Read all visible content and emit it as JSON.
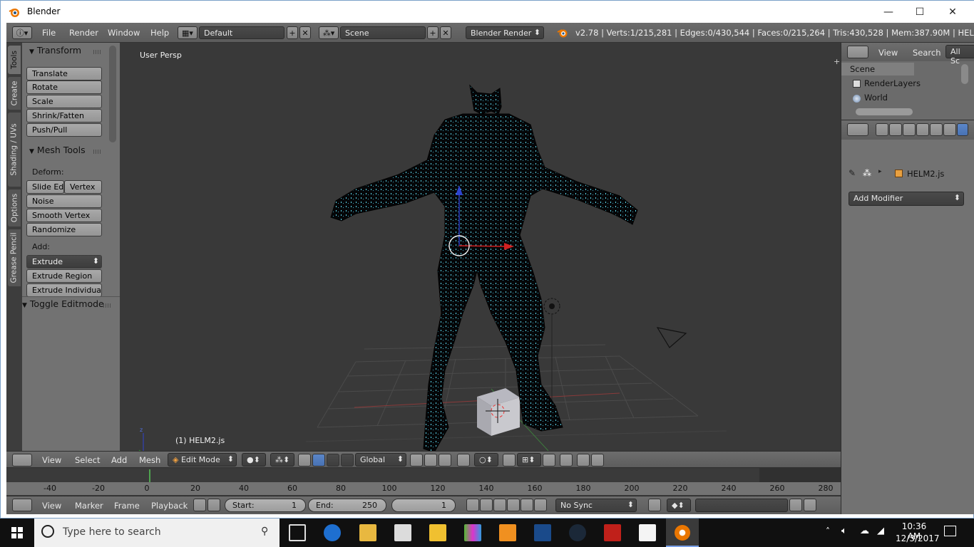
{
  "window": {
    "title": "Blender",
    "controls": [
      "—",
      "☐",
      "✕"
    ]
  },
  "info_header": {
    "menus": [
      "File",
      "Render",
      "Window",
      "Help"
    ],
    "layout": "Default",
    "scene": "Scene",
    "engine": "Blender Render",
    "stats": "v2.78 | Verts:1/215,281 | Edges:0/430,544 | Faces:0/215,264 | Tris:430,528 | Mem:387.90M | HELM2.js"
  },
  "tool_tabs": [
    "Tools",
    "Create",
    "Shading / UVs",
    "Options",
    "Grease Pencil"
  ],
  "toolshelf": {
    "transform_header": "Transform",
    "transform_buttons": [
      "Translate",
      "Rotate",
      "Scale",
      "Shrink/Fatten",
      "Push/Pull"
    ],
    "mesh_tools_header": "Mesh Tools",
    "deform_label": "Deform:",
    "slide_edge": "Slide Ed",
    "vertex": "Vertex",
    "deform_buttons": [
      "Noise",
      "Smooth Vertex",
      "Randomize"
    ],
    "add_label": "Add:",
    "extrude": "Extrude",
    "extrude_region": "Extrude Region",
    "extrude_individual": "Extrude Individual",
    "toggle_editmode_header": "Toggle Editmode"
  },
  "viewport": {
    "view_name": "User Persp",
    "object_label": "(1) HELM2.js"
  },
  "view3d_header": {
    "menus": [
      "View",
      "Select",
      "Add",
      "Mesh"
    ],
    "mode": "Edit Mode",
    "orientation": "Global"
  },
  "timeline": {
    "ticks": [
      "-40",
      "-20",
      "0",
      "20",
      "40",
      "60",
      "80",
      "100",
      "120",
      "140",
      "160",
      "180",
      "200",
      "220",
      "240",
      "260",
      "280"
    ],
    "menus": [
      "View",
      "Marker",
      "Frame",
      "Playback"
    ],
    "start_label": "Start:",
    "start_value": "1",
    "end_label": "End:",
    "end_value": "250",
    "current_frame": "1",
    "sync": "No Sync"
  },
  "outliner": {
    "menus": [
      "View",
      "Search"
    ],
    "filter": "All Sc",
    "items": [
      "Scene",
      "RenderLayers",
      "World"
    ]
  },
  "properties": {
    "object_name": "HELM2.js",
    "add_modifier": "Add Modifier"
  },
  "taskbar": {
    "search_placeholder": "Type here to search",
    "time": "10:36 AM",
    "date": "12/3/2017"
  },
  "colors": {
    "blender_bg": "#484848",
    "viewport": "#393939",
    "selected_vertex": "#6ff0ff",
    "accent": "#5b86c8"
  }
}
